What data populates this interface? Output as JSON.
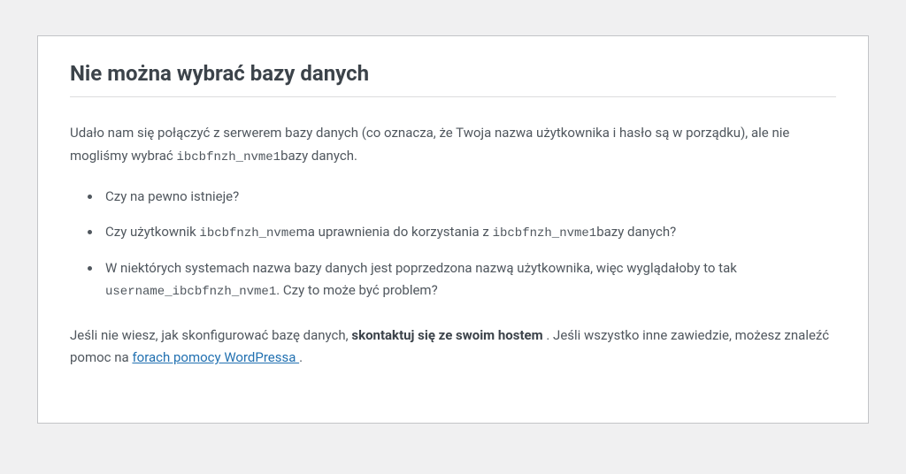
{
  "heading": "Nie można wybrać bazy danych",
  "intro": {
    "p1a": "Udało nam się połączyć z serwerem bazy danych (co oznacza, że Twoja nazwa użytkownika i hasło są w porządku), ale nie mogliśmy wybrać ",
    "dbname": "ibcbfnzh_nvme1",
    "p1b": "bazy danych."
  },
  "bullets": {
    "b1": "Czy na pewno istnieje?",
    "b2": {
      "a": "Czy użytkownik ",
      "user": "ibcbfnzh_nvme",
      "b": "ma uprawnienia do korzystania z ",
      "db": "ibcbfnzh_nvme1",
      "c": "bazy danych?"
    },
    "b3": {
      "a": "W niektórych systemach nazwa bazy danych jest poprzedzona nazwą użytkownika, więc wyglądałoby to tak ",
      "example": "username_ibcbfnzh_nvme1",
      "b": ". Czy to może być problem?"
    }
  },
  "outro": {
    "a": "Jeśli nie wiesz, jak skonfigurować bazę danych, ",
    "strong": "skontaktuj się ze swoim hostem ",
    "b": ". Jeśli wszystko inne zawiedzie, możesz znaleźć pomoc na ",
    "link": "forach pomocy WordPressa ",
    "c": "."
  }
}
